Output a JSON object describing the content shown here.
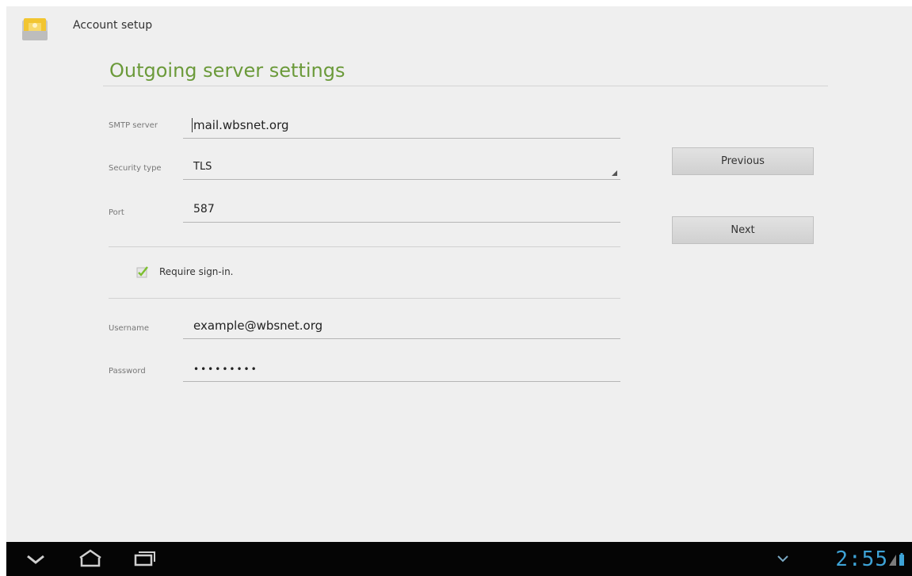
{
  "header": {
    "title": "Account setup",
    "app_icon": "email-icon"
  },
  "form": {
    "section_title": "Outgoing server settings",
    "smtp": {
      "label": "SMTP server",
      "value": "mail.wbsnet.org"
    },
    "security": {
      "label": "Security type",
      "value": "TLS"
    },
    "port": {
      "label": "Port",
      "value": "587"
    },
    "require_signin": {
      "label": "Require sign-in.",
      "checked": true
    },
    "username": {
      "label": "Username",
      "value": "example@wbsnet.org"
    },
    "password": {
      "label": "Password",
      "value": "•••••••••"
    }
  },
  "buttons": {
    "previous": "Previous",
    "next": "Next"
  },
  "navbar": {
    "icons": [
      "back-icon",
      "home-icon",
      "recent-apps-icon"
    ],
    "clock": "2:55",
    "status_icons": [
      "notification-icon",
      "signal-icon",
      "battery-icon"
    ]
  },
  "colors": {
    "accent": "#6b9a3a",
    "clock": "#3ea3d6"
  }
}
